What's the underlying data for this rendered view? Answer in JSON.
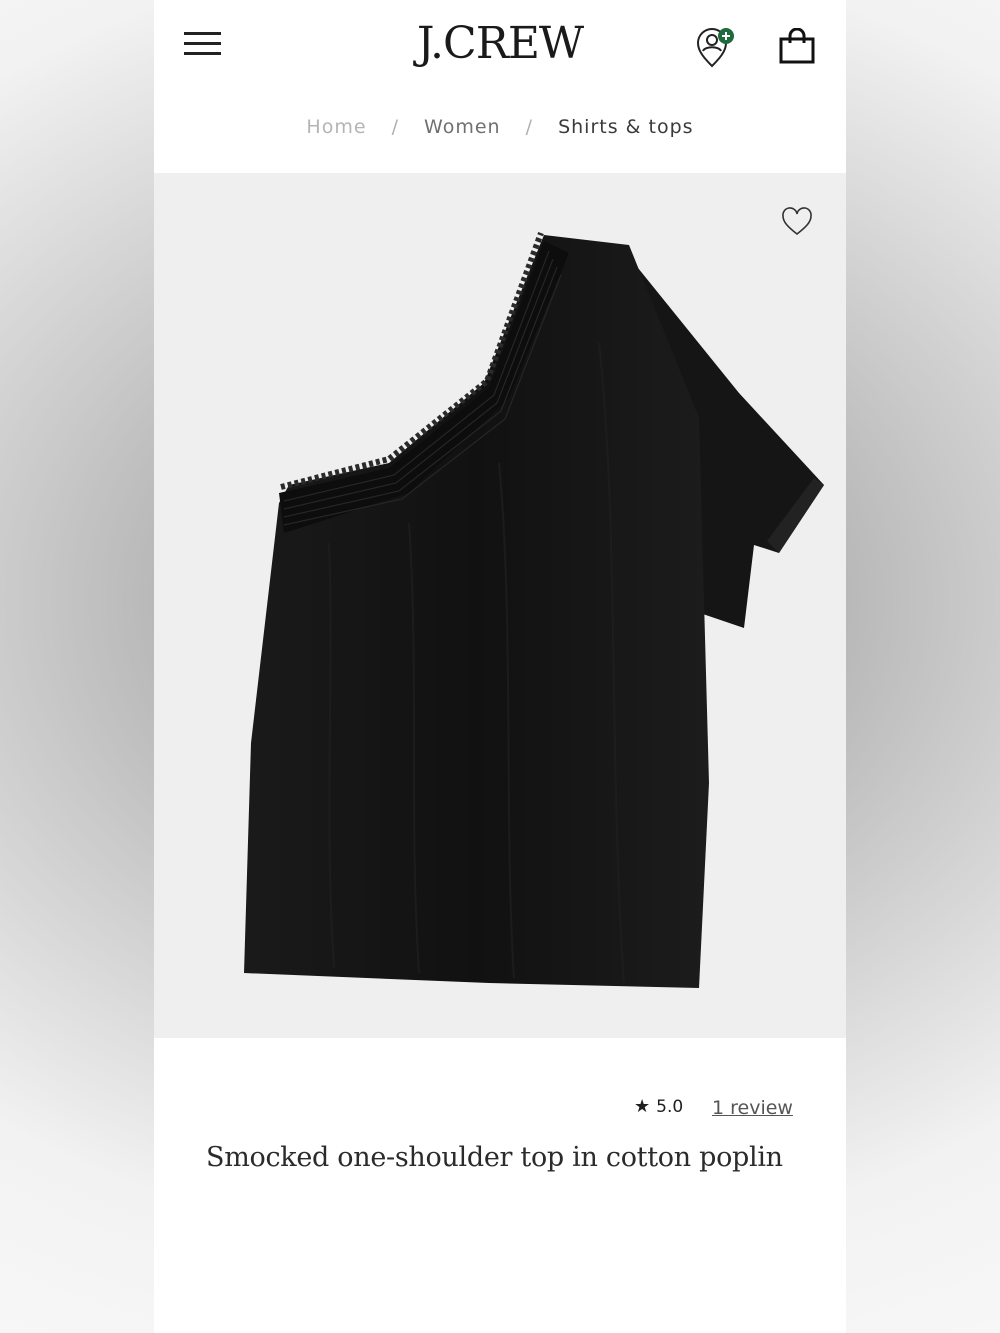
{
  "header": {
    "logo": "J.CREW",
    "menu_icon": "hamburger-menu-icon",
    "account_icon": "account-location-icon",
    "account_badge_color": "#1f6b3e",
    "bag_icon": "shopping-bag-icon"
  },
  "breadcrumb": {
    "items": [
      "Home",
      "Women",
      "Shirts & tops"
    ],
    "separator": "/"
  },
  "product": {
    "image": "black one-shoulder smocked top",
    "wishlist_icon": "heart-icon",
    "rating_star": "★",
    "rating": "5.0",
    "reviews_link": "1 review",
    "title": "Smocked one-shoulder top in cotton poplin"
  }
}
